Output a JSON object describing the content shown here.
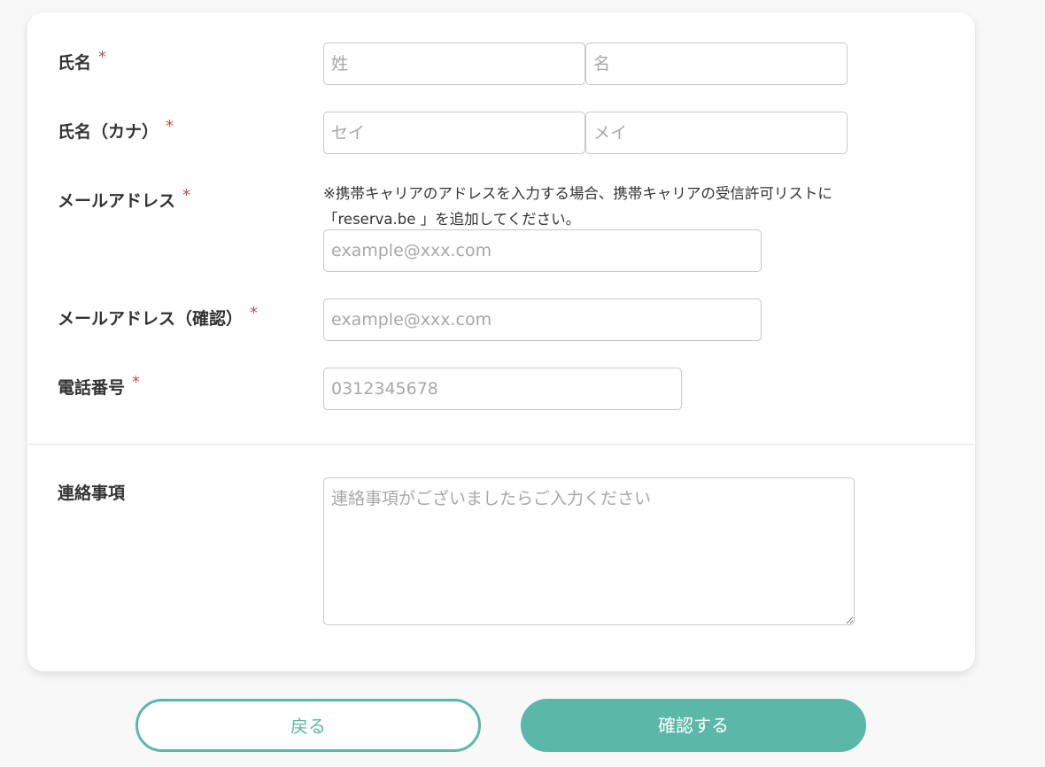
{
  "form": {
    "name": {
      "label": "氏名",
      "required_mark": "*",
      "last_placeholder": "姓",
      "first_placeholder": "名"
    },
    "kana": {
      "label": "氏名（カナ）",
      "required_mark": "*",
      "last_placeholder": "セイ",
      "first_placeholder": "メイ"
    },
    "email": {
      "label": "メールアドレス",
      "required_mark": "*",
      "note": "※携帯キャリアのアドレスを入力する場合、携帯キャリアの受信許可リストに「reserva.be 」を追加してください。",
      "placeholder": "example@xxx.com"
    },
    "email_confirm": {
      "label": "メールアドレス（確認）",
      "required_mark": "*",
      "placeholder": "example@xxx.com"
    },
    "phone": {
      "label": "電話番号",
      "required_mark": "*",
      "placeholder": "0312345678"
    },
    "message": {
      "label": "連絡事項",
      "placeholder": "連絡事項がございましたらご入力ください"
    }
  },
  "buttons": {
    "back_label": "戻る",
    "confirm_label": "確認する"
  },
  "colors": {
    "accent": "#5bb8a8",
    "required": "#c0504d"
  }
}
